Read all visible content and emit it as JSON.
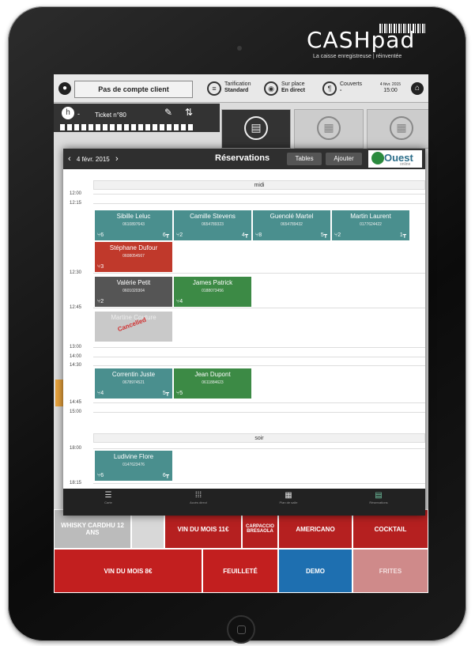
{
  "brand": {
    "logo": "CASHpad",
    "tagline": "La caisse enregistreuse | réinventée"
  },
  "topbar": {
    "client": "Pas de compte client",
    "tarification_label": "Tarification",
    "tarification_value": "Standard",
    "place_label": "Sur place",
    "place_value": "En direct",
    "couverts_label": "Couverts",
    "couverts_value": "-",
    "date": "4 févr. 2015",
    "time": "15:00"
  },
  "ticket": {
    "label": "Ticket n°80",
    "prefix": "-"
  },
  "reservations": {
    "date": "4 févr. 2015",
    "title": "Réservations",
    "btn_tables": "Tables",
    "btn_add": "Ajouter",
    "partner_logo": "Ouest",
    "partner_sub": "online",
    "section_midi": "midi",
    "section_soir": "soir",
    "times": {
      "t1200": "12:00",
      "t1215": "12:15",
      "t1230": "12:30",
      "t1245": "12:45",
      "t1300": "13:00",
      "t1400": "14:00",
      "t1430": "14:30",
      "t1445": "14:45",
      "t1500": "15:00",
      "t1800": "18:00",
      "t1815": "18:15"
    },
    "cards": [
      {
        "name": "Sibille Leluc",
        "phone": "0610897643",
        "covers": "6",
        "table": "6"
      },
      {
        "name": "Camille Stevens",
        "phone": "0654789323",
        "covers": "2",
        "table": "4"
      },
      {
        "name": "Guenolé  Martel",
        "phone": "0654789432",
        "covers": "8",
        "table": "5"
      },
      {
        "name": "Martin Laurent",
        "phone": "0177624422",
        "covers": "2",
        "table": "1"
      },
      {
        "name": "Stéphane Dufour",
        "phone": "0608054567",
        "covers": "3",
        "table": ""
      },
      {
        "name": "Valérie Petit",
        "phone": "0601020304",
        "covers": "2",
        "table": ""
      },
      {
        "name": "James Patrick",
        "phone": "0188073456",
        "covers": "4",
        "table": ""
      },
      {
        "name": "Martine Couture",
        "phone": "",
        "covers": "",
        "table": "",
        "status": "Cancelled"
      },
      {
        "name": "Correntin Juste",
        "phone": "0678974521",
        "covers": "4",
        "table": "5"
      },
      {
        "name": "Jean Dupont",
        "phone": "0611884623",
        "covers": "5",
        "table": ""
      },
      {
        "name": "Ludivine Flore",
        "phone": "0147623476",
        "covers": "6",
        "table": "6"
      }
    ],
    "footer": [
      {
        "label": "Carte"
      },
      {
        "label": "Accès direct"
      },
      {
        "label": "Plan de salle"
      },
      {
        "label": "Réservations"
      }
    ]
  },
  "products": {
    "whisky": "WHISKY CARDHU 12 ANS",
    "vin11": "VIN DU MOIS 11€",
    "carpaccio": "CARPACCIO BRESAOLA",
    "americano": "AMERICANO",
    "cocktail": "COCKTAIL",
    "vin8": "VIN DU MOIS 8€",
    "feuillete": "FEUILLETÉ",
    "demo": "DEMO",
    "frites": "FRITES"
  },
  "colors": {
    "teal": "#4a8f8e",
    "red": "#c0392b",
    "green": "#3c8a45",
    "blue": "#1e6fb0",
    "dark": "#555555"
  }
}
